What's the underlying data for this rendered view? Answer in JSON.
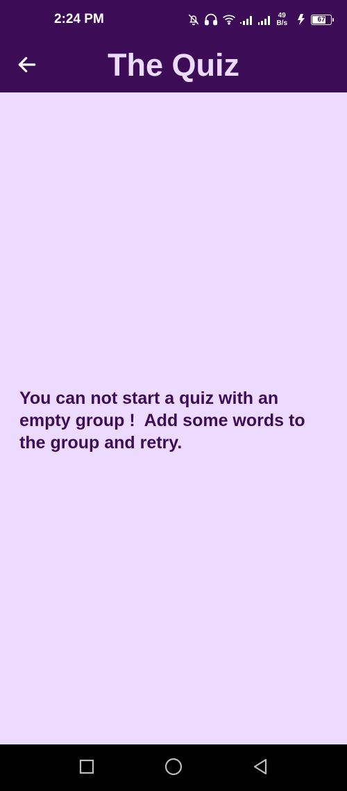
{
  "status_bar": {
    "time": "2:24 PM",
    "net_speed_value": "49",
    "net_speed_unit": "B/s",
    "battery_level": "67",
    "icons": [
      "bell-off-icon",
      "headphones-icon",
      "wifi-icon",
      "signal-icon",
      "signal-icon",
      "charging-icon",
      "battery-icon"
    ]
  },
  "app_bar": {
    "title": "The Quiz",
    "back_icon": "arrow-left-icon"
  },
  "content": {
    "message": "You can not start a quiz with an empty group !  Add some words to the group and retry."
  },
  "nav_bar": {
    "buttons": [
      "recents-square-icon",
      "home-circle-icon",
      "back-triangle-icon"
    ]
  },
  "colors": {
    "primary": "#3c0d56",
    "background": "#eddbff",
    "title_text": "#eddbff",
    "message_text": "#3c0d56",
    "nav_bar": "#000000"
  }
}
